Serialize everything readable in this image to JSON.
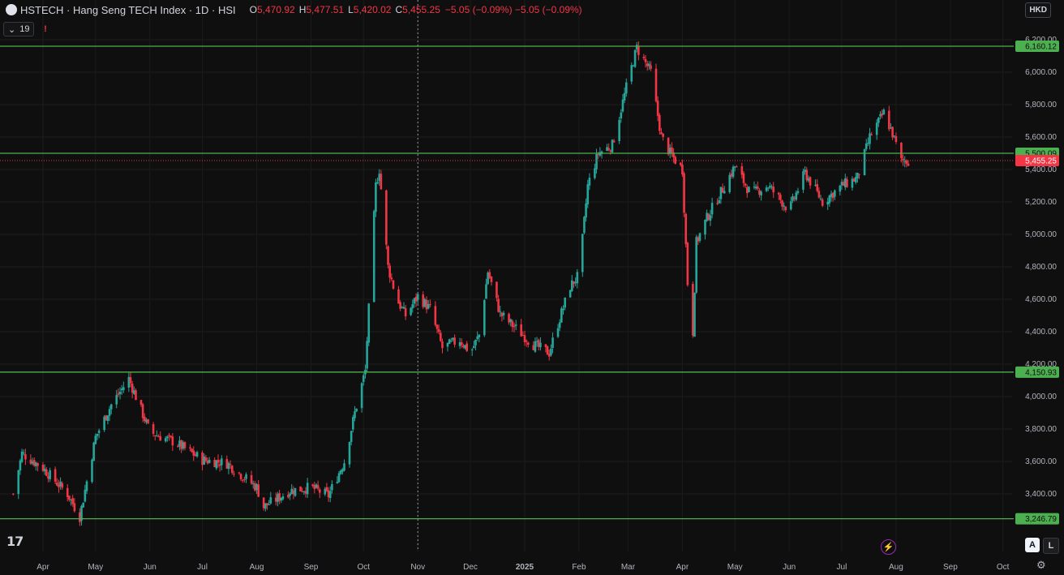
{
  "header": {
    "title": "HSTECH · Hang Seng TECH Index · 1D · HSI",
    "o_label": "O",
    "o": "5,470.92",
    "h_label": "H",
    "h": "5,477.51",
    "l_label": "L",
    "l": "5,420.02",
    "c_label": "C",
    "c": "5,455.25",
    "change": "−5.05 (−0.09%) −5.05 (−0.09%)"
  },
  "indicators": {
    "count": "19",
    "alert_icon": "!"
  },
  "currency": "HKD",
  "colors": {
    "up": "#26a69a",
    "down": "#f23645",
    "level": "#4caf50",
    "price_line": "#f23645"
  },
  "icons": {
    "logo": "tradingview-logo-icon",
    "lightning": "lightning-icon",
    "settings": "gear-icon"
  },
  "axis_buttons": {
    "auto": "A",
    "log": "L"
  },
  "chart_data": {
    "type": "candlestick",
    "y_ticks": [
      "3,400.00",
      "3,600.00",
      "3,800.00",
      "4,000.00",
      "4,200.00",
      "4,400.00",
      "4,600.00",
      "4,800.00",
      "5,000.00",
      "5,200.00",
      "5,400.00",
      "5,600.00",
      "5,800.00",
      "6,000.00",
      "6,200.00"
    ],
    "y_tick_values": [
      3400,
      3600,
      3800,
      4000,
      4200,
      4400,
      4600,
      4800,
      5000,
      5200,
      5400,
      5600,
      5800,
      6000,
      6200
    ],
    "x_ticks": [
      "Apr",
      "May",
      "Jun",
      "Jul",
      "Aug",
      "Sep",
      "Oct",
      "Nov",
      "Dec",
      "2025",
      "Feb",
      "Mar",
      "Apr",
      "May",
      "Jun",
      "Jul",
      "Aug",
      "Sep",
      "Oct"
    ],
    "x_tick_dates": [
      "2024-04-01",
      "2024-05-01",
      "2024-06-01",
      "2024-07-01",
      "2024-08-01",
      "2024-09-01",
      "2024-10-01",
      "2024-11-01",
      "2024-12-01",
      "2025-01-01",
      "2025-02-01",
      "2025-03-01",
      "2025-04-01",
      "2025-05-01",
      "2025-06-01",
      "2025-07-01",
      "2025-08-01",
      "2025-09-01",
      "2025-10-01"
    ],
    "levels": [
      {
        "value": 6160.12,
        "label": "6,160.12"
      },
      {
        "value": 5500.09,
        "label": "5,500.09"
      },
      {
        "value": 4150.93,
        "label": "4,150.93"
      },
      {
        "value": 3246.79,
        "label": "3,246.79"
      }
    ],
    "last_price": {
      "value": 5455.25,
      "label": "5,455.25"
    },
    "crosshair_date": "2024-11-01",
    "path_dates": [
      "2024-03-15",
      "2024-03-20",
      "2024-04-01",
      "2024-04-15",
      "2024-04-22",
      "2024-05-01",
      "2024-05-10",
      "2024-05-20",
      "2024-06-01",
      "2024-06-15",
      "2024-07-01",
      "2024-07-15",
      "2024-08-01",
      "2024-08-05",
      "2024-08-20",
      "2024-09-01",
      "2024-09-11",
      "2024-09-20",
      "2024-09-26",
      "2024-10-02",
      "2024-10-08",
      "2024-10-10",
      "2024-10-15",
      "2024-10-20",
      "2024-10-25",
      "2024-11-01",
      "2024-11-08",
      "2024-11-15",
      "2024-11-25",
      "2024-12-01",
      "2024-12-06",
      "2024-12-11",
      "2024-12-18",
      "2024-12-25",
      "2025-01-06",
      "2025-01-15",
      "2025-01-20",
      "2025-01-27",
      "2025-02-01",
      "2025-02-06",
      "2025-02-12",
      "2025-02-20",
      "2025-03-01",
      "2025-03-06",
      "2025-03-14",
      "2025-03-20",
      "2025-03-25",
      "2025-04-01",
      "2025-04-04",
      "2025-04-07",
      "2025-04-09",
      "2025-04-15",
      "2025-04-25",
      "2025-05-01",
      "2025-05-10",
      "2025-05-20",
      "2025-06-01",
      "2025-06-10",
      "2025-06-20",
      "2025-07-01",
      "2025-07-10",
      "2025-07-17",
      "2025-07-25",
      "2025-07-30",
      "2025-08-04",
      "2025-08-08"
    ],
    "path_values": [
      3400,
      3650,
      3560,
      3400,
      3260,
      3750,
      3950,
      4110,
      3780,
      3720,
      3610,
      3590,
      3440,
      3320,
      3420,
      3440,
      3390,
      3600,
      3900,
      4160,
      5300,
      5400,
      4800,
      4600,
      4500,
      4620,
      4540,
      4300,
      4350,
      4270,
      4380,
      4770,
      4510,
      4440,
      4320,
      4270,
      4450,
      4680,
      4750,
      5300,
      5500,
      5550,
      5950,
      6150,
      6000,
      5600,
      5500,
      5400,
      4700,
      4400,
      4950,
      5100,
      5300,
      5420,
      5250,
      5300,
      5150,
      5380,
      5200,
      5300,
      5350,
      5600,
      5750,
      5620,
      5450,
      5455
    ]
  }
}
